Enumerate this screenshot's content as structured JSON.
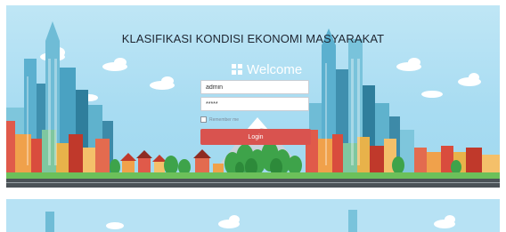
{
  "page": {
    "title": "KLASIFIKASI KONDISI EKONOMI MASYARAKAT"
  },
  "login": {
    "welcome": "Welcome",
    "username_value": "admin",
    "password_value": "*****",
    "remember_label": "Remember me",
    "button_label": "Login"
  },
  "colors": {
    "sky": "#a8dcf2",
    "button": "#d9534f",
    "road": "#4b5257"
  }
}
